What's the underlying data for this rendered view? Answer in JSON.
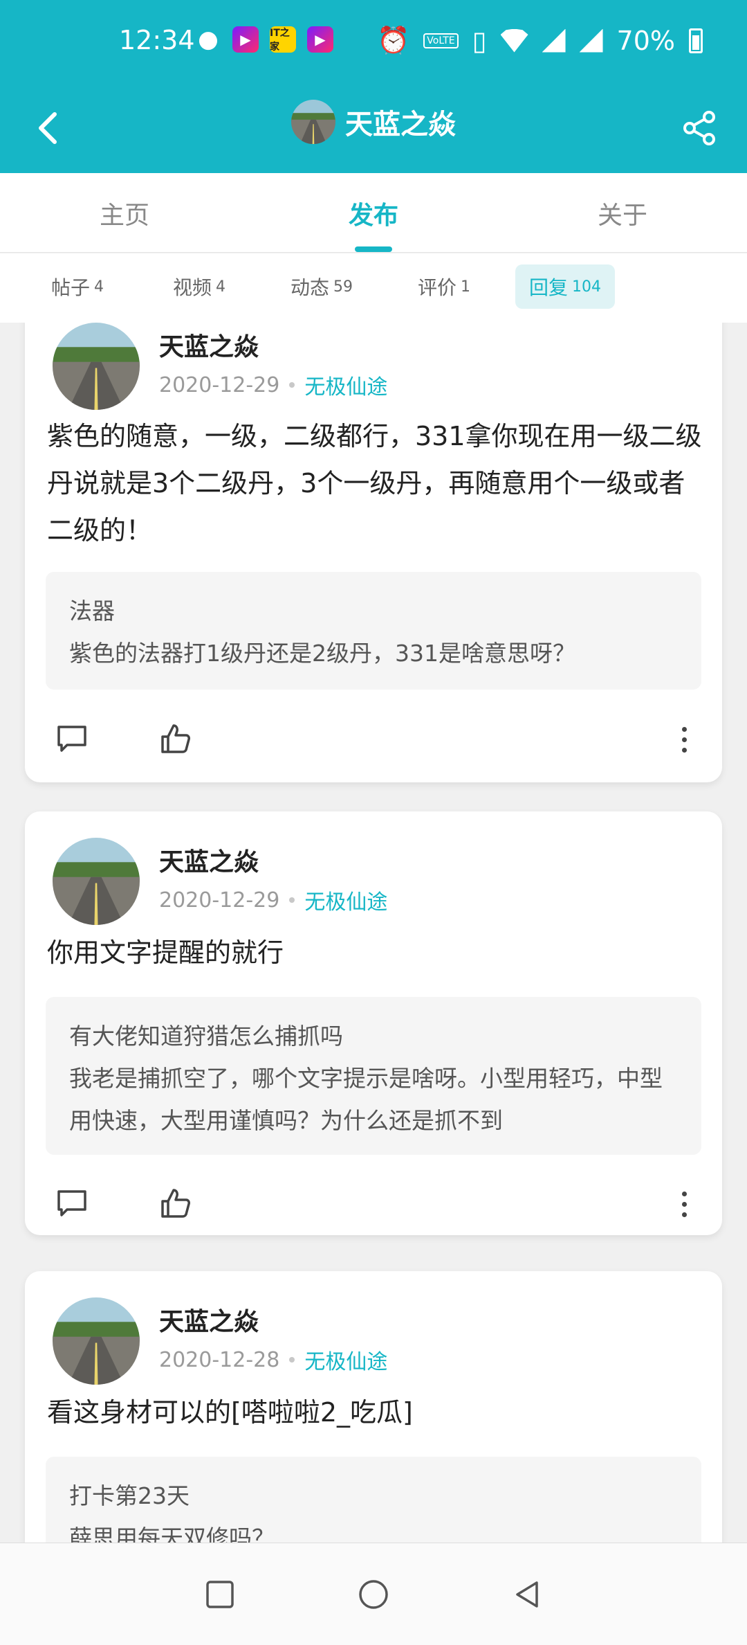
{
  "status": {
    "time": "12:34",
    "battery": "70%",
    "app_news_label": "IT之家",
    "lte_label": "VoLTE"
  },
  "header": {
    "title": "天蓝之焱",
    "back_icon": "chevron-left-icon",
    "share_icon": "share-icon"
  },
  "tabs": [
    {
      "label": "主页",
      "active": false
    },
    {
      "label": "发布",
      "active": true
    },
    {
      "label": "关于",
      "active": false
    }
  ],
  "subtabs": [
    {
      "label": "帖子",
      "count": "4"
    },
    {
      "label": "视频",
      "count": "4"
    },
    {
      "label": "动态",
      "count": "59"
    },
    {
      "label": "评价",
      "count": "1"
    },
    {
      "label": "回复",
      "count": "104",
      "active": true
    }
  ],
  "posts": [
    {
      "author": "天蓝之焱",
      "date": "2020-12-29",
      "game": "无极仙途",
      "content": "紫色的随意，一级，二级都行，331拿你现在用一级二级丹说就是3个二级丹，3个一级丹，再随意用个一级或者二级的！",
      "quote_title": "法器",
      "quote_text": "紫色的法器打1级丹还是2级丹，331是啥意思呀？"
    },
    {
      "author": "天蓝之焱",
      "date": "2020-12-29",
      "game": "无极仙途",
      "content": "你用文字提醒的就行",
      "quote_title": "有大佬知道狩猎怎么捕抓吗",
      "quote_text": "我老是捕抓空了，哪个文字提示是啥呀。小型用轻巧，中型用快速，大型用谨慎吗？为什么还是抓不到"
    },
    {
      "author": "天蓝之焱",
      "date": "2020-12-28",
      "game": "无极仙途",
      "content": "看这身材可以的[嗒啦啦2_吃瓜]",
      "quote_title": "打卡第23天",
      "quote_text": "薛思用每天双修吗？"
    }
  ],
  "colors": {
    "accent": "#16b6c6",
    "background": "#f0f0f0"
  }
}
